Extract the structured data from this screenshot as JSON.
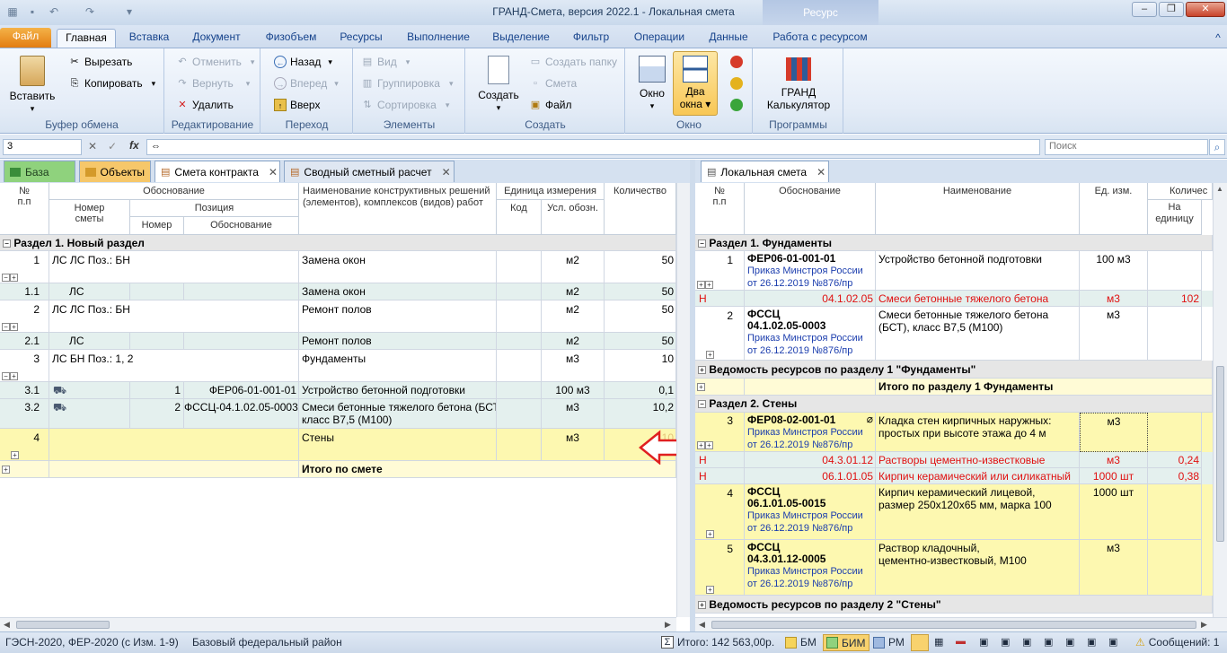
{
  "window": {
    "title": "ГРАНД-Смета, версия 2022.1 - Локальная смета",
    "context_tab_group": "Ресурс"
  },
  "ribbon_tabs": [
    "Файл",
    "Главная",
    "Вставка",
    "Документ",
    "Физобъем",
    "Ресурсы",
    "Выполнение",
    "Выделение",
    "Фильтр",
    "Операции",
    "Данные",
    "Работа с ресурсом"
  ],
  "ribbon": {
    "clipboard": {
      "label": "Буфер обмена",
      "paste": "Вставить",
      "cut": "Вырезать",
      "copy": "Копировать"
    },
    "edit": {
      "label": "Редактирование",
      "undo": "Отменить",
      "redo": "Вернуть",
      "delete": "Удалить"
    },
    "nav": {
      "label": "Переход",
      "back": "Назад",
      "forward": "Вперед",
      "up": "Вверх"
    },
    "elements": {
      "label": "Элементы",
      "view": "Вид",
      "grouping": "Группировка",
      "sort": "Сортировка"
    },
    "create": {
      "label": "Создать",
      "create": "Создать",
      "create_folder": "Создать папку",
      "estimate": "Смета",
      "file": "Файл"
    },
    "window": {
      "label": "Окно",
      "window": "Окно",
      "two_windows_1": "Два",
      "two_windows_2": "окна"
    },
    "programs": {
      "label": "Программы",
      "calc_1": "ГРАНД",
      "calc_2": "Калькулятор"
    }
  },
  "formula_bar": {
    "cell_ref": "3",
    "value": "⇔",
    "search_placeholder": "Поиск"
  },
  "left_tabs": {
    "base": "База",
    "objects": "Объекты",
    "contract": "Смета контракта",
    "summary": "Сводный сметный расчет"
  },
  "left_grid": {
    "headers": {
      "num": "№\nп.п",
      "justification": "Обоснование",
      "estimate_num": "Номер\nсметы",
      "position": "Позиция",
      "pos_num": "Номер",
      "pos_just": "Обоснование",
      "name": "Наименование конструктивных решений (элементов), комплексов (видов) работ",
      "unit": "Единица измерения",
      "code": "Код",
      "symbol": "Усл. обозн.",
      "qty": "Количество"
    },
    "section": "Раздел 1. Новый раздел",
    "rows": [
      {
        "n": "1",
        "est": "ЛС ЛС Поз.: БН",
        "pnum": "",
        "pjust": "",
        "name": "Замена окон",
        "code": "",
        "unit": "м2",
        "qty": "50"
      },
      {
        "n": "1.1",
        "est": "ЛС",
        "pnum": "",
        "pjust": "",
        "name": "Замена окон",
        "code": "",
        "unit": "м2",
        "qty": "50"
      },
      {
        "n": "2",
        "est": "ЛС ЛС Поз.: БН",
        "pnum": "",
        "pjust": "",
        "name": "Ремонт полов",
        "code": "",
        "unit": "м2",
        "qty": "50"
      },
      {
        "n": "2.1",
        "est": "ЛС",
        "pnum": "",
        "pjust": "",
        "name": "Ремонт полов",
        "code": "",
        "unit": "м2",
        "qty": "50"
      },
      {
        "n": "3",
        "est": "ЛС БН Поз.: 1, 2",
        "pnum": "",
        "pjust": "",
        "name": "Фундаменты",
        "code": "",
        "unit": "м3",
        "qty": "10"
      },
      {
        "n": "3.1",
        "est": "",
        "pnum": "1",
        "pjust": "ФЕР06-01-001-01",
        "name": "Устройство бетонной подготовки",
        "code": "",
        "unit": "100 м3",
        "qty": "0,1"
      },
      {
        "n": "3.2",
        "est": "",
        "pnum": "2",
        "pjust": "ФССЦ-04.1.02.05-0003",
        "name": "Смеси бетонные тяжелого бетона (БСТ),",
        "name2": "класс В7,5 (М100)",
        "code": "",
        "unit": "м3",
        "qty": "10,2"
      },
      {
        "n": "4",
        "est": "",
        "pnum": "",
        "pjust": "",
        "name": "Стены",
        "code": "",
        "unit": "м3",
        "qty": "10"
      }
    ],
    "total": "Итого по смете"
  },
  "right_tab": "Локальная смета",
  "right_grid": {
    "headers": {
      "num": "№\nп.п",
      "just": "Обоснование",
      "name": "Наименование",
      "unit": "Ед. изм.",
      "qty": "Количес",
      "per_unit": "На\nединицу"
    },
    "sec1": "Раздел 1. Фундаменты",
    "r1": {
      "n": "1",
      "code": "ФЕР06-01-001-01",
      "order1": "Приказ Минстроя России",
      "order2": "от 26.12.2019 №876/пр",
      "name": "Устройство бетонной подготовки",
      "unit": "100 м3"
    },
    "r1n": {
      "mark": "Н",
      "code": "04.1.02.05",
      "name": "Смеси бетонные тяжелого бетона",
      "unit": "м3",
      "qty": "102"
    },
    "r2": {
      "n": "2",
      "code1": "ФССЦ",
      "code2": "04.1.02.05-0003",
      "order1": "Приказ Минстроя России",
      "order2": "от 26.12.2019 №876/пр",
      "name1": "Смеси бетонные тяжелого бетона",
      "name2": "(БСТ), класс В7,5 (М100)",
      "unit": "м3"
    },
    "res1": "Ведомость ресурсов по разделу 1 \"Фундаменты\"",
    "total1": "Итого по разделу 1 Фундаменты",
    "sec2": "Раздел 2. Стены",
    "r3": {
      "n": "3",
      "code": "ФЕР08-02-001-01",
      "order1": "Приказ Минстроя России",
      "order2": "от 26.12.2019 №876/пр",
      "name1": "Кладка стен кирпичных наружных:",
      "name2": "простых при высоте этажа до 4 м",
      "unit": "м3"
    },
    "r3n1": {
      "mark": "Н",
      "code": "04.3.01.12",
      "name": "Растворы цементно-известковые",
      "unit": "м3",
      "qty": "0,24"
    },
    "r3n2": {
      "mark": "Н",
      "code": "06.1.01.05",
      "name": "Кирпич керамический или силикатный",
      "unit": "1000 шт",
      "qty": "0,38"
    },
    "r4": {
      "n": "4",
      "code1": "ФССЦ",
      "code2": "06.1.01.05-0015",
      "order1": "Приказ Минстроя России",
      "order2": "от 26.12.2019 №876/пр",
      "name1": "Кирпич керамический лицевой,",
      "name2": "размер 250х120х65 мм, марка 100",
      "unit": "1000 шт"
    },
    "r5": {
      "n": "5",
      "code1": "ФССЦ",
      "code2": "04.3.01.12-0005",
      "order1": "Приказ Минстроя России",
      "order2": "от 26.12.2019 №876/пр",
      "name1": "Раствор кладочный,",
      "name2": "цементно-известковый, М100",
      "unit": "м3"
    },
    "res2": "Ведомость ресурсов по разделу 2 \"Стены\""
  },
  "status": {
    "norms": "ГЭСН-2020, ФЕР-2020 (с Изм. 1-9)",
    "region": "Базовый федеральный район",
    "total": "Итого: 142 563,00р.",
    "bm": "БМ",
    "bim": "БИМ",
    "rm": "РМ",
    "messages": "Сообщений: 1"
  },
  "colors": {
    "ribbon_bg": "#e4ecf7",
    "section_bg": "#e6e6e6",
    "highlight": "#fdf8b0",
    "resource_text": "#e01010",
    "order_text": "#1c3eae",
    "arrow": "#e02020"
  }
}
